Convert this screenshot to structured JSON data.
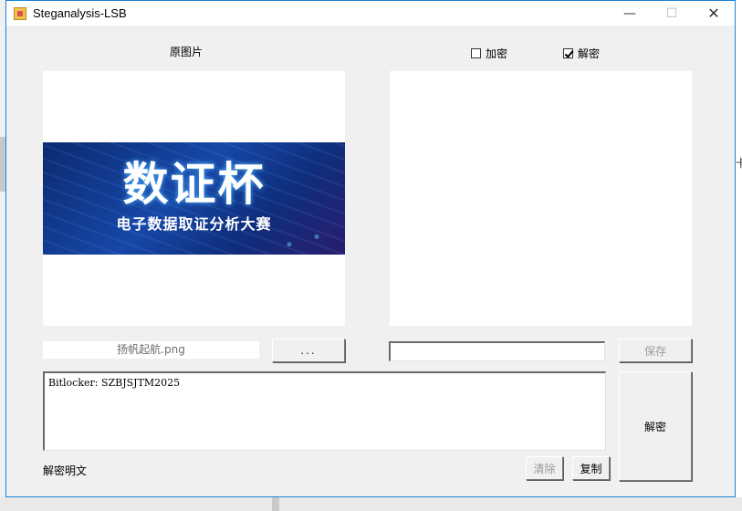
{
  "window": {
    "title": "Steganalysis-LSB",
    "controls": {
      "minimize": "—",
      "maximize": "☐",
      "close": "✕"
    }
  },
  "source": {
    "label": "原图片",
    "banner_title": "数证杯",
    "banner_subtitle": "电子数据取证分析大赛",
    "filename": "扬帆起航.png",
    "browse_label": "..."
  },
  "mode": {
    "encrypt_label": "加密",
    "encrypt_checked": false,
    "decrypt_label": "解密",
    "decrypt_checked": true
  },
  "output": {
    "save_path_value": "",
    "save_label": "保存"
  },
  "result": {
    "text": "Bitlocker: SZBJSJTM2025",
    "caption": "解密明文",
    "clear_label": "清除",
    "copy_label": "复制",
    "decrypt_label": "解密"
  },
  "backdrop": {
    "side_glyph": "卡"
  }
}
